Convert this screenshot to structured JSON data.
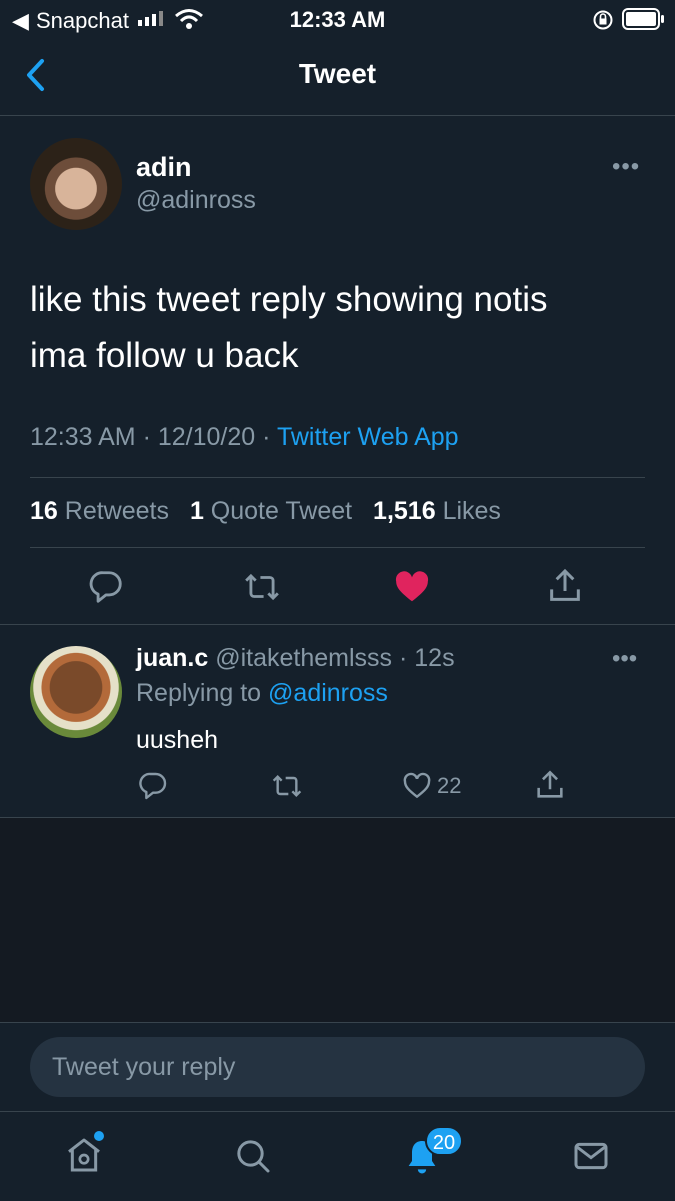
{
  "status_bar": {
    "back_glyph": "◀",
    "app": "Snapchat",
    "time": "12:33 AM"
  },
  "header": {
    "title": "Tweet"
  },
  "tweet": {
    "name": "adin",
    "handle": "@adinross",
    "text_line1": "like this tweet reply showing notis",
    "text_line2": "ima follow u back",
    "time": "12:33 AM",
    "date": "12/10/20",
    "separator": "·",
    "source": "Twitter Web App",
    "retweets_count": "16",
    "retweets_label": "Retweets",
    "quote_count": "1",
    "quote_label": "Quote Tweet",
    "likes_count": "1,516",
    "likes_label": "Likes",
    "more": "•••"
  },
  "reply": {
    "name": "juan.c",
    "handle": "@itakethemlsss",
    "age": "· 12s",
    "replying_prefix": "Replying to",
    "replying_to": "@adinross",
    "text": "uusheh",
    "like_count": "22",
    "more": "•••"
  },
  "compose": {
    "placeholder": "Tweet your reply"
  },
  "tabbar": {
    "notifications_badge": "20"
  },
  "colors": {
    "background": "#15202b",
    "accent": "#1da1f2",
    "like": "#e0245e",
    "muted": "#8899a6",
    "divider": "#38444d"
  },
  "icons": [
    "chevron-left-icon",
    "wifi-icon",
    "lock-rotation-icon",
    "battery-icon",
    "reply-icon",
    "retweet-icon",
    "heart-icon",
    "share-icon",
    "home-icon",
    "search-icon",
    "bell-icon",
    "mail-icon"
  ]
}
